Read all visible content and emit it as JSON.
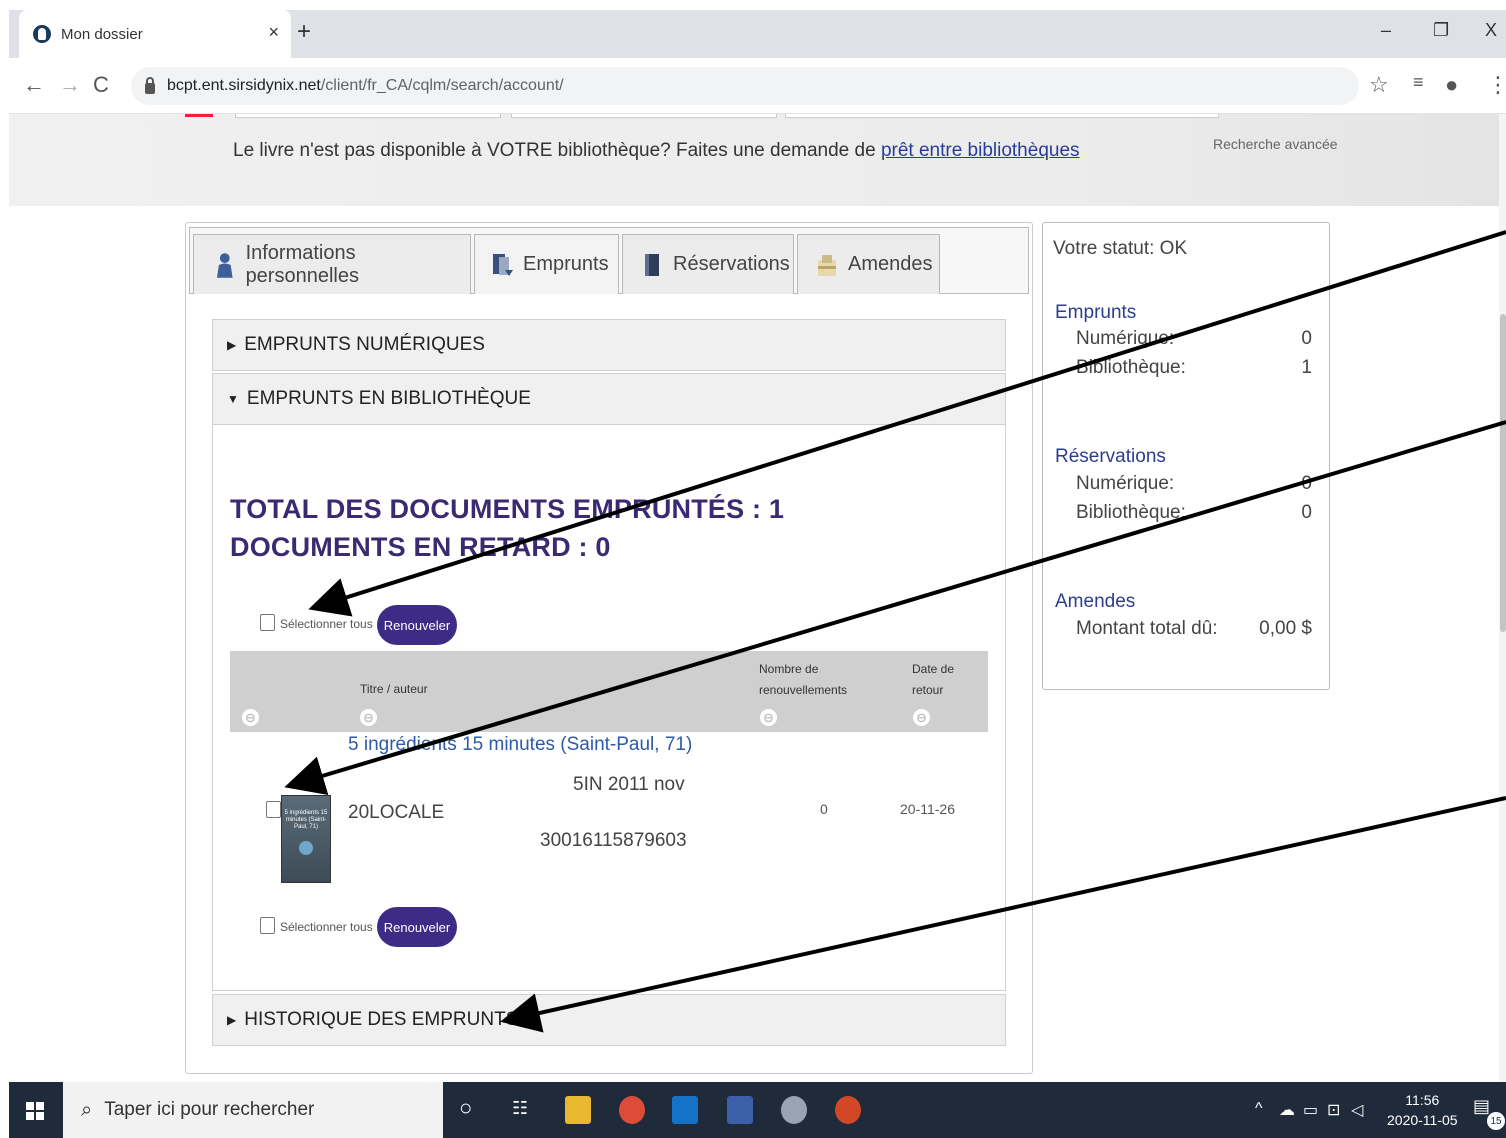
{
  "browser": {
    "tab_title": "Mon dossier",
    "tab_close": "×",
    "new_tab": "+",
    "url_host": "bcpt.ent.sirsidynix.net",
    "url_path": "/client/fr_CA/cqlm/search/account/",
    "win_min": "–",
    "win_max": "❐",
    "win_close": "X"
  },
  "banner": {
    "message": "Le livre n'est pas disponible à VOTRE bibliothèque? Faites une demande de",
    "link": "prêt entre bibliothèques",
    "advanced_search": "Recherche avancée"
  },
  "tabs": [
    {
      "label": "Informations personnelles",
      "icon": "person-icon"
    },
    {
      "label": "Emprunts",
      "icon": "checkout-icon"
    },
    {
      "label": "Réservations",
      "icon": "book-icon"
    },
    {
      "label": "Amendes",
      "icon": "fines-icon"
    }
  ],
  "sections": {
    "digital": "EMPRUNTS NUMÉRIQUES",
    "library": "EMPRUNTS EN BIBLIOTHÈQUE",
    "history": "HISTORIQUE DES EMPRUNTS"
  },
  "summary": {
    "total": "TOTAL DES DOCUMENTS EMPRUNTÉS : 1",
    "overdue": "DOCUMENTS EN RETARD : 0"
  },
  "controls": {
    "select_all": "Sélectionner tous",
    "renew": "Renouveler"
  },
  "table": {
    "col_title": "Titre / auteur",
    "col_renewals_1": "Nombre de",
    "col_renewals_2": "renouvellements",
    "col_due_1": "Date de",
    "col_due_2": "retour",
    "sort_symbol": "⊖",
    "rows": [
      {
        "title": "5 ingrédients 15 minutes (Saint-Paul, 71)",
        "call_number": "5IN 2011 nov",
        "location": "20LOCALE",
        "barcode": "30016115879603",
        "renewals": "0",
        "due": "20-11-26",
        "cover_text": "5 ingrédients 15 minutes (Saint-Paul, 71)"
      }
    ]
  },
  "status": {
    "title": "Votre statut: OK",
    "checkouts_head": "Emprunts",
    "checkouts_digital_label": "Numérique:",
    "checkouts_digital_val": "0",
    "checkouts_library_label": "Bibliothèque:",
    "checkouts_library_val": "1",
    "holds_head": "Réservations",
    "holds_digital_label": "Numérique:",
    "holds_digital_val": "0",
    "holds_library_label": "Bibliothèque:",
    "holds_library_val": "0",
    "fines_head": "Amendes",
    "fines_label": "Montant total dû:",
    "fines_val": "0,00 $"
  },
  "taskbar": {
    "search_placeholder": "Taper ici pour rechercher",
    "time": "11:56",
    "date": "2020-11-05",
    "notifications": "15"
  },
  "colors": {
    "accent": "#3d2b86",
    "heading": "#3b2a72",
    "link": "#283c9c"
  }
}
